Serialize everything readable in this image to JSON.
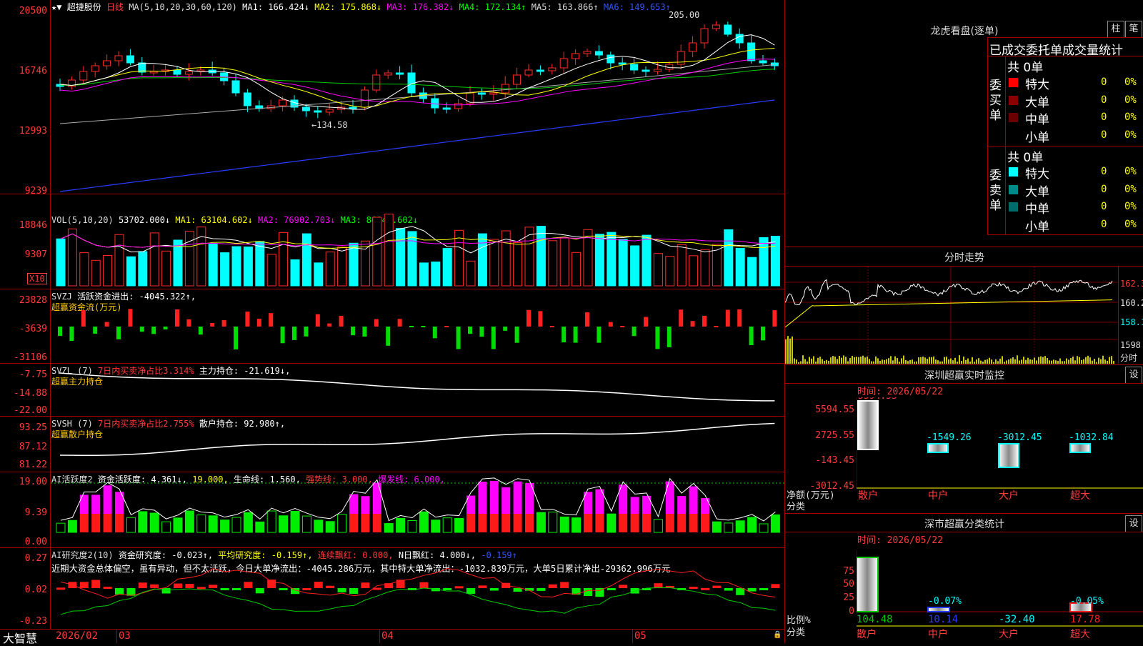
{
  "main": {
    "title": "超捷股份",
    "period": "日线",
    "ma_legend": [
      "MA(5,10,20,30,60,120)",
      "MA1: 166.424↓",
      "MA2: 175.868↓",
      "MA3: 176.382↓",
      "MA4: 172.134↑",
      "MA5: 163.866↑",
      "MA6: 149.653↑"
    ],
    "yticks": [
      "20500",
      "16746",
      "12993",
      "9239"
    ],
    "high_label": "205.00",
    "low_label": "134.58"
  },
  "vol": {
    "legend": [
      "VOL(5,10,20)",
      "53702.000↓",
      "MA1: 63104.602↓",
      "MA2: 76902.703↓",
      "MA3: 86041.602↓"
    ],
    "yticks": [
      "18846",
      "9307"
    ],
    "unit": "X10"
  },
  "svzj": {
    "legend": [
      "SVZJ",
      "活跃资金进出: -4045.322↑,"
    ],
    "sub": "超赢资金流(万元)",
    "yticks": [
      "23828",
      "-3639",
      "-31106"
    ]
  },
  "svzl": {
    "legend": [
      "SVZL (7)",
      "7日内买卖净占比3.314%",
      "主力持仓: -21.619↓,"
    ],
    "sub": "超赢主力持仓",
    "yticks": [
      "-7.75",
      "-14.88",
      "-22.00"
    ]
  },
  "svsh": {
    "legend": [
      "SVSH (7)",
      "7日内买卖净占比2.755%",
      "散户持仓: 92.980↑,"
    ],
    "sub": "超赢散户持仓",
    "yticks": [
      "93.25",
      "87.12",
      "81.22"
    ]
  },
  "ai1": {
    "legend": [
      "AI活跃度2",
      "资金活跃度: 4.361↓,",
      "19.000,",
      "生命线: 1.560,",
      "强势线: 3.000,",
      "爆发线: 6.000,"
    ],
    "yticks": [
      "19.00",
      "9.39",
      "0.00"
    ]
  },
  "ai2": {
    "legend": [
      "AI研究度2(10)",
      "资金研究度: -0.023↑,",
      "平均研究度: -0.159↑,",
      "连续飘红: 0.000,",
      "N日飘红: 4.000↓,",
      "-0.159↑"
    ],
    "note": "近期大资金总体偏空，虽有异动，但不太活跃，今日大单净流出：-4045.286万元，其中特大单净流出：-1032.839万元，大单5日累计净出-29362.996万元",
    "yticks": [
      "0.27",
      "0.02",
      "-0.23"
    ]
  },
  "xaxis": {
    "brand": "大智慧",
    "labels": [
      "2026/02",
      "03",
      "04",
      "05"
    ]
  },
  "dragon": {
    "title": "龙虎看盘(逐单)",
    "btn1": "柱",
    "btn2": "笔",
    "heading": "已成交委托单成交量统计",
    "buy_side": "委买单",
    "sell_side": "委卖单",
    "buy_total": "共 0单",
    "sell_total": "共 0单",
    "buy_rows": [
      {
        "name": "特大",
        "val": "0",
        "pct": "0%",
        "color": "#ff0000"
      },
      {
        "name": "大单",
        "val": "0",
        "pct": "0%",
        "color": "#8b0000"
      },
      {
        "name": "中单",
        "val": "0",
        "pct": "0%",
        "color": "#6b0000"
      },
      {
        "name": "小单",
        "val": "0",
        "pct": "0%",
        "color": ""
      }
    ],
    "sell_rows": [
      {
        "name": "特大",
        "val": "0",
        "pct": "0%",
        "color": "#00ffff"
      },
      {
        "name": "大单",
        "val": "0",
        "pct": "0%",
        "color": "#008b8b"
      },
      {
        "name": "中单",
        "val": "0",
        "pct": "0%",
        "color": "#006b6b"
      },
      {
        "name": "小单",
        "val": "0",
        "pct": "0%",
        "color": ""
      }
    ]
  },
  "intraday": {
    "title": "分时走势",
    "yticks": [
      "162.3",
      "160.2",
      "158.1"
    ],
    "vol_tick": "1598",
    "xlabel": "分时"
  },
  "monitor": {
    "title": "深圳超赢实时监控",
    "btn": "设",
    "time": "时间: 2026/05/22",
    "yticks": [
      "5594.55",
      "2725.55",
      "-143.45",
      "-3012.45"
    ],
    "ylabel1": "净额(万元)",
    "ylabel2": "分类",
    "bars": [
      {
        "cat": "散户",
        "val": "5594.55"
      },
      {
        "cat": "中户",
        "val": "-1549.26"
      },
      {
        "cat": "大户",
        "val": "-3012.45"
      },
      {
        "cat": "超大",
        "val": "-1032.84"
      }
    ]
  },
  "classify": {
    "title": "深市超赢分类统计",
    "btn": "设",
    "time": "时间: 2026/05/22",
    "yticks": [
      "75",
      "50",
      "25",
      "0"
    ],
    "ylabel1": "比例%",
    "ylabel2": "分类",
    "bars": [
      {
        "cat": "散户",
        "val": "104.48",
        "pct": ""
      },
      {
        "cat": "中户",
        "val": "10.14",
        "pct": "-0.07%"
      },
      {
        "cat": "大户",
        "val": "-32.40",
        "pct": ""
      },
      {
        "cat": "超大",
        "val": "17.78",
        "pct": "-0.05%"
      }
    ]
  }
}
